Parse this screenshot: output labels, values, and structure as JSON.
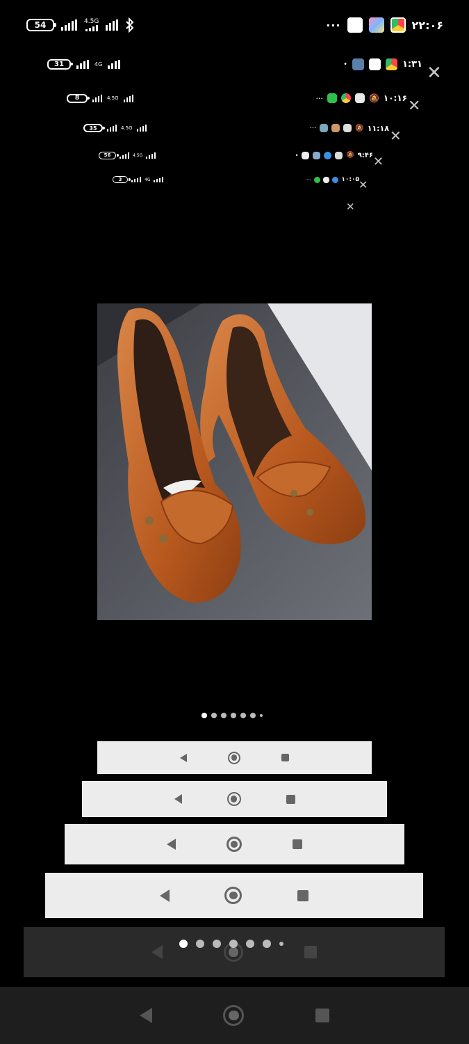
{
  "status_bar": {
    "battery": "54",
    "network": "4.5G",
    "time": "۲۲:۰۶",
    "overflow": "···"
  },
  "nested_status": [
    {
      "battery": "31",
      "network": "4G",
      "time": "۱:۳۱"
    },
    {
      "battery": "8",
      "network": "4.5G",
      "time": "۱۰:۱۶"
    },
    {
      "battery": "35",
      "network": "4.5G",
      "time": "۱۱:۱۸"
    },
    {
      "battery": "56",
      "network": "4.5G",
      "time": "۹:۴۶"
    },
    {
      "battery": "3",
      "network": "4G",
      "time": "۱۰:۰۵"
    }
  ],
  "close_glyph": "✕",
  "gallery": {
    "page_count": 7,
    "current_index": 0
  },
  "colors": {
    "background": "#000000",
    "shoe": "#c0642a",
    "navbar_light": "#ececec",
    "navbar_dark": "#2a2a2a",
    "system_nav": "#1e1e1e"
  }
}
